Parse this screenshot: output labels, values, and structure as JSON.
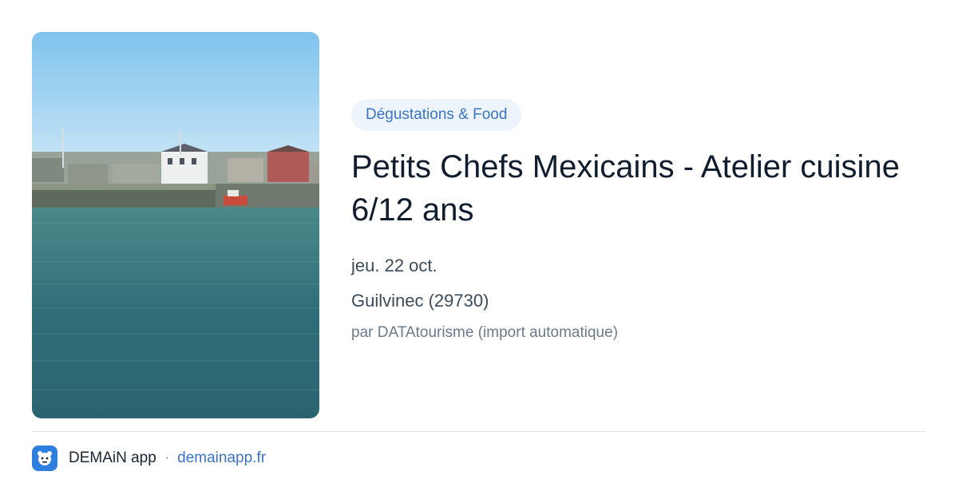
{
  "event": {
    "category": "Dégustations & Food",
    "title": "Petits Chefs Mexicains - Atelier cuisine 6/12 ans",
    "date": "jeu. 22 oct.",
    "location": "Guilvinec (29730)",
    "source": "par DATAtourisme (import automatique)"
  },
  "footer": {
    "app_name": "DEMAiN app",
    "separator": "·",
    "domain": "demainapp.fr"
  },
  "colors": {
    "accent": "#3a74c8",
    "tag_background": "#eef4fb",
    "title": "#0f1d2e",
    "app_icon": "#2f7fe0"
  }
}
